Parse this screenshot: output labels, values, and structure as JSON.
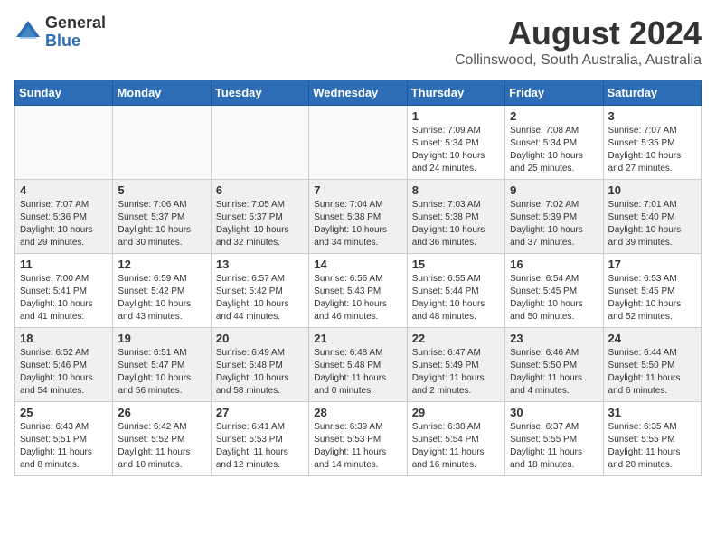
{
  "header": {
    "logo_general": "General",
    "logo_blue": "Blue",
    "month_title": "August 2024",
    "location": "Collinswood, South Australia, Australia"
  },
  "calendar": {
    "days_of_week": [
      "Sunday",
      "Monday",
      "Tuesday",
      "Wednesday",
      "Thursday",
      "Friday",
      "Saturday"
    ],
    "weeks": [
      {
        "bg": "white",
        "days": [
          {
            "number": "",
            "info": ""
          },
          {
            "number": "",
            "info": ""
          },
          {
            "number": "",
            "info": ""
          },
          {
            "number": "",
            "info": ""
          },
          {
            "number": "1",
            "info": "Sunrise: 7:09 AM\nSunset: 5:34 PM\nDaylight: 10 hours\nand 24 minutes."
          },
          {
            "number": "2",
            "info": "Sunrise: 7:08 AM\nSunset: 5:34 PM\nDaylight: 10 hours\nand 25 minutes."
          },
          {
            "number": "3",
            "info": "Sunrise: 7:07 AM\nSunset: 5:35 PM\nDaylight: 10 hours\nand 27 minutes."
          }
        ]
      },
      {
        "bg": "gray",
        "days": [
          {
            "number": "4",
            "info": "Sunrise: 7:07 AM\nSunset: 5:36 PM\nDaylight: 10 hours\nand 29 minutes."
          },
          {
            "number": "5",
            "info": "Sunrise: 7:06 AM\nSunset: 5:37 PM\nDaylight: 10 hours\nand 30 minutes."
          },
          {
            "number": "6",
            "info": "Sunrise: 7:05 AM\nSunset: 5:37 PM\nDaylight: 10 hours\nand 32 minutes."
          },
          {
            "number": "7",
            "info": "Sunrise: 7:04 AM\nSunset: 5:38 PM\nDaylight: 10 hours\nand 34 minutes."
          },
          {
            "number": "8",
            "info": "Sunrise: 7:03 AM\nSunset: 5:38 PM\nDaylight: 10 hours\nand 36 minutes."
          },
          {
            "number": "9",
            "info": "Sunrise: 7:02 AM\nSunset: 5:39 PM\nDaylight: 10 hours\nand 37 minutes."
          },
          {
            "number": "10",
            "info": "Sunrise: 7:01 AM\nSunset: 5:40 PM\nDaylight: 10 hours\nand 39 minutes."
          }
        ]
      },
      {
        "bg": "white",
        "days": [
          {
            "number": "11",
            "info": "Sunrise: 7:00 AM\nSunset: 5:41 PM\nDaylight: 10 hours\nand 41 minutes."
          },
          {
            "number": "12",
            "info": "Sunrise: 6:59 AM\nSunset: 5:42 PM\nDaylight: 10 hours\nand 43 minutes."
          },
          {
            "number": "13",
            "info": "Sunrise: 6:57 AM\nSunset: 5:42 PM\nDaylight: 10 hours\nand 44 minutes."
          },
          {
            "number": "14",
            "info": "Sunrise: 6:56 AM\nSunset: 5:43 PM\nDaylight: 10 hours\nand 46 minutes."
          },
          {
            "number": "15",
            "info": "Sunrise: 6:55 AM\nSunset: 5:44 PM\nDaylight: 10 hours\nand 48 minutes."
          },
          {
            "number": "16",
            "info": "Sunrise: 6:54 AM\nSunset: 5:45 PM\nDaylight: 10 hours\nand 50 minutes."
          },
          {
            "number": "17",
            "info": "Sunrise: 6:53 AM\nSunset: 5:45 PM\nDaylight: 10 hours\nand 52 minutes."
          }
        ]
      },
      {
        "bg": "gray",
        "days": [
          {
            "number": "18",
            "info": "Sunrise: 6:52 AM\nSunset: 5:46 PM\nDaylight: 10 hours\nand 54 minutes."
          },
          {
            "number": "19",
            "info": "Sunrise: 6:51 AM\nSunset: 5:47 PM\nDaylight: 10 hours\nand 56 minutes."
          },
          {
            "number": "20",
            "info": "Sunrise: 6:49 AM\nSunset: 5:48 PM\nDaylight: 10 hours\nand 58 minutes."
          },
          {
            "number": "21",
            "info": "Sunrise: 6:48 AM\nSunset: 5:48 PM\nDaylight: 11 hours\nand 0 minutes."
          },
          {
            "number": "22",
            "info": "Sunrise: 6:47 AM\nSunset: 5:49 PM\nDaylight: 11 hours\nand 2 minutes."
          },
          {
            "number": "23",
            "info": "Sunrise: 6:46 AM\nSunset: 5:50 PM\nDaylight: 11 hours\nand 4 minutes."
          },
          {
            "number": "24",
            "info": "Sunrise: 6:44 AM\nSunset: 5:50 PM\nDaylight: 11 hours\nand 6 minutes."
          }
        ]
      },
      {
        "bg": "white",
        "days": [
          {
            "number": "25",
            "info": "Sunrise: 6:43 AM\nSunset: 5:51 PM\nDaylight: 11 hours\nand 8 minutes."
          },
          {
            "number": "26",
            "info": "Sunrise: 6:42 AM\nSunset: 5:52 PM\nDaylight: 11 hours\nand 10 minutes."
          },
          {
            "number": "27",
            "info": "Sunrise: 6:41 AM\nSunset: 5:53 PM\nDaylight: 11 hours\nand 12 minutes."
          },
          {
            "number": "28",
            "info": "Sunrise: 6:39 AM\nSunset: 5:53 PM\nDaylight: 11 hours\nand 14 minutes."
          },
          {
            "number": "29",
            "info": "Sunrise: 6:38 AM\nSunset: 5:54 PM\nDaylight: 11 hours\nand 16 minutes."
          },
          {
            "number": "30",
            "info": "Sunrise: 6:37 AM\nSunset: 5:55 PM\nDaylight: 11 hours\nand 18 minutes."
          },
          {
            "number": "31",
            "info": "Sunrise: 6:35 AM\nSunset: 5:55 PM\nDaylight: 11 hours\nand 20 minutes."
          }
        ]
      }
    ]
  }
}
